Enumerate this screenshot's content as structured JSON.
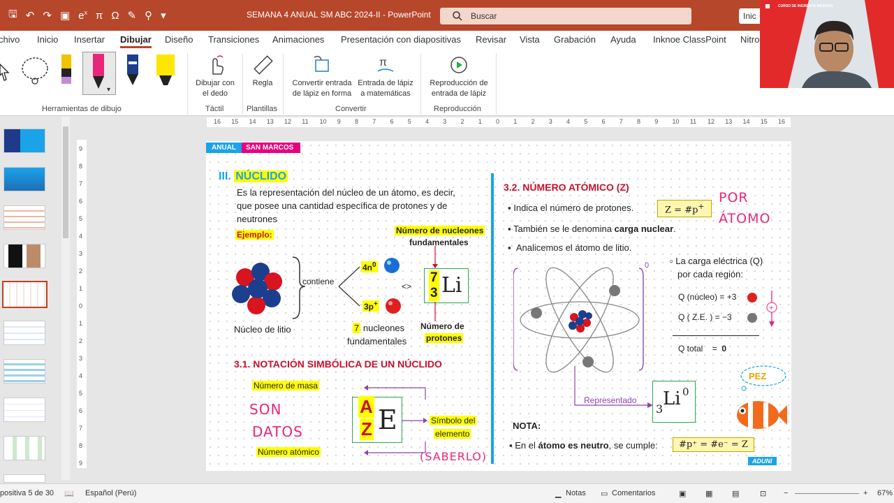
{
  "window": {
    "title": "SEMANA 4  ANUAL SM ABC 2024-II  -  PowerPoint",
    "search_placeholder": "Buscar",
    "start_button": "Inic",
    "accent": "#b7472a"
  },
  "menu": {
    "tabs": [
      "chivo",
      "Inicio",
      "Insertar",
      "Dibujar",
      "Diseño",
      "Transiciones",
      "Animaciones",
      "Presentación con diapositivas",
      "Revisar",
      "Vista",
      "Grabación",
      "Ayuda",
      "Inknoe ClassPoint",
      "Nitro"
    ],
    "active": "Dibujar"
  },
  "ribbon": {
    "groups": {
      "tools": "Herramientas de dibujo",
      "touch": "Táctil",
      "templates": "Plantillas",
      "convert": "Convertir",
      "replay": "Reproducción"
    },
    "buttons": {
      "draw_finger_1": "Dibujar con",
      "draw_finger_2": "el dedo",
      "ruler": "Regla",
      "ink_shape_1": "Convertir entrada",
      "ink_shape_2": "de lápiz en forma",
      "ink_math_1": "Entrada de lápiz",
      "ink_math_2": "a matemáticas",
      "ink_replay_1": "Reproducción de",
      "ink_replay_2": "entrada de lápiz"
    }
  },
  "ruler": {
    "h_ticks": [
      "16",
      "15",
      "14",
      "13",
      "12",
      "11",
      "10",
      "9",
      "8",
      "7",
      "6",
      "5",
      "4",
      "3",
      "2",
      "1",
      "0",
      "1",
      "2",
      "3",
      "4",
      "5",
      "6",
      "7",
      "8",
      "9",
      "10",
      "11",
      "12",
      "13",
      "14",
      "15",
      "16"
    ],
    "v_ticks": [
      "9",
      "8",
      "7",
      "6",
      "5",
      "4",
      "3",
      "2",
      "1",
      "0",
      "1",
      "2",
      "3",
      "4",
      "5",
      "6",
      "7",
      "8",
      "9"
    ]
  },
  "slide": {
    "tag_anual": "ANUAL",
    "tag_sm": "SAN MARCOS",
    "section_num": "III.",
    "section_title": "NÚCLIDO",
    "definition_1": "Es la representación del núcleo de un átomo, es decir,",
    "definition_2": "que posee una cantidad específica de protones y de",
    "definition_3": "neutrones",
    "example": "Ejemplo:",
    "contains": "contiene",
    "nucleus_caption": "Núcleo de litio",
    "neutrons": "4n",
    "neutrons_sup": "0",
    "protons": "3p",
    "protons_sup": "+",
    "nucleons_count": "7",
    "nucleons_label": "nucleones",
    "nucleons_label2": "fundamentales",
    "nucleon_number_1": "Número de nucleones",
    "nucleon_number_2": "fundamentales",
    "equiv": "<>",
    "li_mass": "7",
    "li_atomic": "3",
    "li_symbol": "Li",
    "proton_number_1": "Número de",
    "proton_number_2": "protones",
    "notation_title": "3.1. NOTACIÓN SIMBÓLICA DE UN NÚCLIDO",
    "mass_number": "Número de masa",
    "atomic_number": "Número atómico",
    "element_symbol_1": "Símbolo del",
    "element_symbol_2": "elemento",
    "a_letter": "A",
    "z_letter": "Z",
    "e_letter": "E",
    "hand_son": "SON",
    "hand_datos": "DATOS",
    "hand_saberlo": "(SABERLO)",
    "atomic_title": "3.2. NÚMERO ATÓMICO (Z)",
    "bullet_1": "Indica el número de protones.",
    "z_formula": "Z = #p",
    "z_formula_sup": "+",
    "hand_por": "POR",
    "hand_atomo": "ÁTOMO",
    "bullet_2_a": "También se le denomina ",
    "bullet_2_b": "carga nuclear",
    "bullet_2_c": ".",
    "bullet_3": "Analicemos el átomo de litio.",
    "bracket_exp": "0",
    "charge_title_1": "La carga eléctrica (Q)",
    "charge_title_2": "por cada región:",
    "q_nucleus": "Q (núcleo) = +3",
    "q_ze": "Q    ( Z.E. ) = −3",
    "q_total": "Q  total",
    "q_total_eq": "=",
    "q_total_val": "0",
    "represented": "Representado",
    "li0_z": "3",
    "li0_sym": "Li",
    "li0_sup": "0",
    "note_title": "NOTA:",
    "note_a": "En el ",
    "note_b": "átomo es neutro",
    "note_c": ", se cumple:",
    "neutral_formula": "#p⁺ = #e⁻ = Z",
    "pez": "PEZ",
    "brand": "ADUNI"
  },
  "status": {
    "slide_of": "positiva 5 de 30",
    "language": "Español (Perú)",
    "notes": "Notas",
    "comments": "Comentarios",
    "zoom": "67%"
  },
  "webcam": {
    "banner": "CURSO DE INGRESOS MASIVOS"
  }
}
